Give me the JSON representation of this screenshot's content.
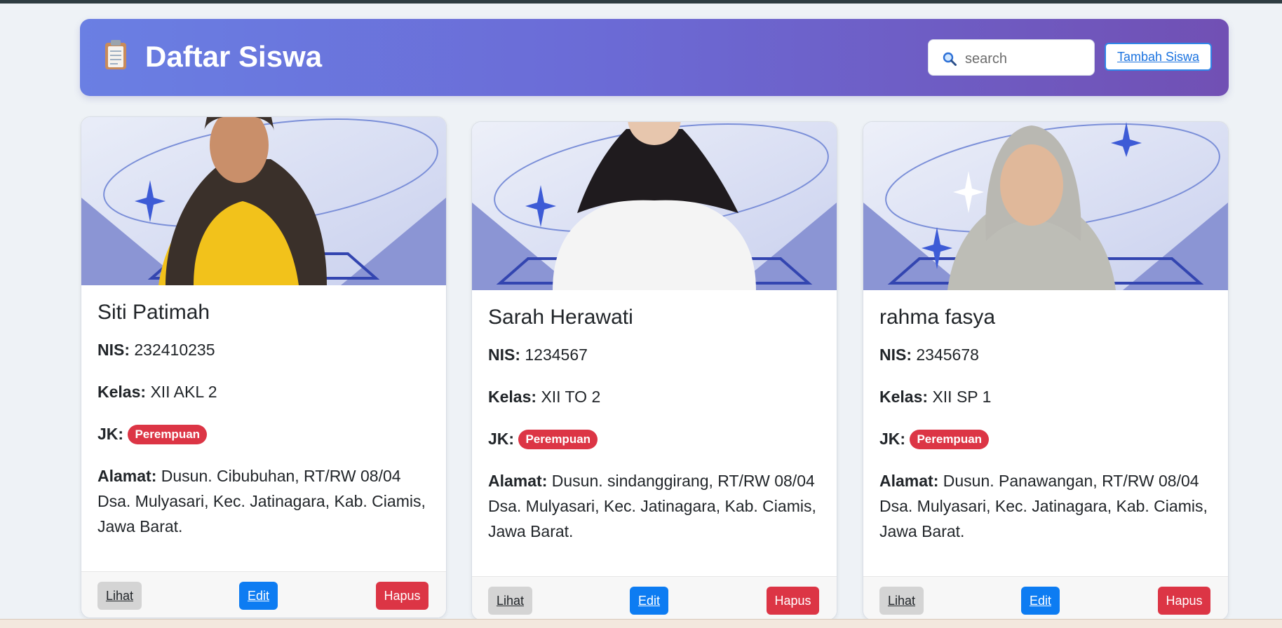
{
  "header": {
    "title": "Daftar Siswa",
    "icon": "clipboard-icon",
    "search_placeholder": "search",
    "search_value": "",
    "add_button": "Tambah Siswa"
  },
  "labels": {
    "nis": "NIS:",
    "kelas": "Kelas:",
    "jk": "JK:",
    "alamat": "Alamat:"
  },
  "actions": {
    "view": "Lihat",
    "edit": "Edit",
    "delete": "Hapus"
  },
  "colors": {
    "header_gradient_start": "#6a7fe3",
    "header_gradient_end": "#7150b4",
    "badge": "#dc3545",
    "edit_button": "#0d7cf2",
    "delete_button": "#dc3545",
    "view_button": "#d4d4d4"
  },
  "students": [
    {
      "name": "Siti Patimah",
      "nis": "232410235",
      "kelas": "XII AKL 2",
      "jk": "Perempuan",
      "alamat": "Dusun. Cibubuhan, RT/RW 08/04 Dsa. Mulyasari, Kec. Jatinagara, Kab. Ciamis, Jawa Barat."
    },
    {
      "name": "Sarah Herawati",
      "nis": "1234567",
      "kelas": "XII TO 2",
      "jk": "Perempuan",
      "alamat": "Dusun. sindanggirang, RT/RW 08/04 Dsa. Mulyasari, Kec. Jatinagara, Kab. Ciamis, Jawa Barat."
    },
    {
      "name": "rahma fasya",
      "nis": "2345678",
      "kelas": "XII SP 1",
      "jk": "Perempuan",
      "alamat": "Dusun. Panawangan, RT/RW 08/04 Dsa. Mulyasari, Kec. Jatinagara, Kab. Ciamis, Jawa Barat."
    }
  ]
}
